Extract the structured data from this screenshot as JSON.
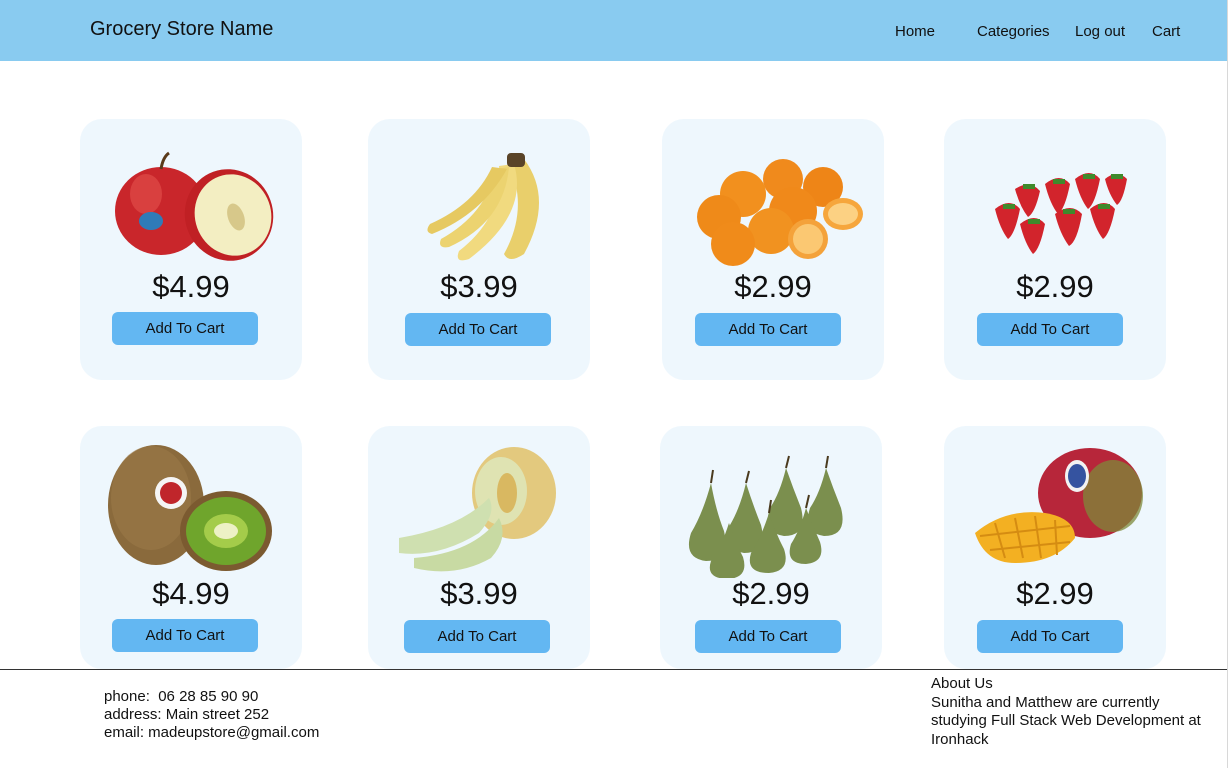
{
  "header": {
    "store_name": "Grocery Store Name",
    "nav": [
      "Home",
      "Categories",
      "Log out",
      "Cart"
    ]
  },
  "products": [
    {
      "fruit": "apple",
      "price": "$4.99",
      "button": "Add To Cart"
    },
    {
      "fruit": "banana",
      "price": "$3.99",
      "button": "Add To Cart"
    },
    {
      "fruit": "orange",
      "price": "$2.99",
      "button": "Add To Cart"
    },
    {
      "fruit": "strawberry",
      "price": "$2.99",
      "button": "Add To Cart"
    },
    {
      "fruit": "kiwi",
      "price": "$4.99",
      "button": "Add To Cart"
    },
    {
      "fruit": "melon",
      "price": "$3.99",
      "button": "Add To Cart"
    },
    {
      "fruit": "pear",
      "price": "$2.99",
      "button": "Add To Cart"
    },
    {
      "fruit": "mango",
      "price": "$2.99",
      "button": "Add To Cart"
    }
  ],
  "footer": {
    "phone": "phone:  06 28 85 90 90",
    "address": "address: Main street 252",
    "email": "email: madeupstore@gmail.com",
    "about_title": "About Us",
    "about_text": "Sunitha and Matthew are currently studying Full Stack Web Development at Ironhack"
  },
  "colors": {
    "header_bg": "#89cbf0",
    "card_bg": "#eef7fd",
    "button_bg": "#63b7f2"
  }
}
